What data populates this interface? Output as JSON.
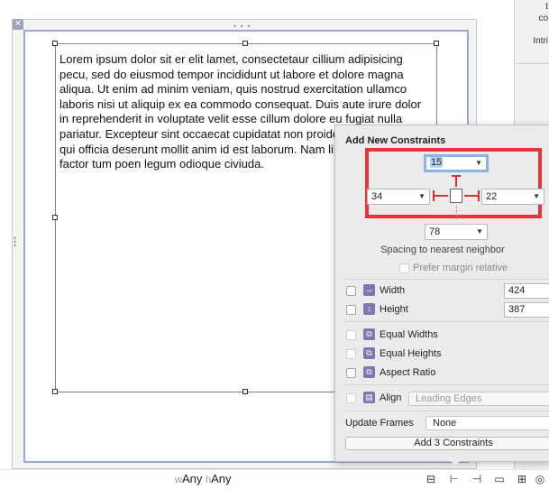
{
  "inspector_fragment": {
    "line1": "t",
    "line2": "co",
    "line3": "Intri"
  },
  "window": {
    "close_glyph": "✕",
    "grip": "• • •"
  },
  "text_view": {
    "content": "Lorem ipsum dolor sit er elit lamet, consectetaur cillium adipisicing pecu, sed do eiusmod tempor incididunt ut labore et dolore magna aliqua. Ut enim ad minim veniam, quis nostrud exercitation ullamco laboris nisi ut aliquip ex ea commodo consequat. Duis aute irure dolor in reprehenderit in voluptate velit esse cillum dolore eu fugiat nulla pariatur. Excepteur sint occaecat cupidatat non proident, sunt in culpa qui officia deserunt mollit anim id est laborum. Nam liber te conscient to factor tum poen legum odioque civiuda."
  },
  "popover": {
    "title": "Add New Constraints",
    "spacing": {
      "top": "15",
      "left": "34",
      "right": "22",
      "bottom": "78"
    },
    "spacing_caption": "Spacing to nearest neighbor",
    "prefer_margin_label": "Prefer margin relative",
    "width": {
      "label": "Width",
      "value": "424"
    },
    "height": {
      "label": "Height",
      "value": "387"
    },
    "equal_widths_label": "Equal Widths",
    "equal_heights_label": "Equal Heights",
    "aspect_ratio_label": "Aspect Ratio",
    "align": {
      "label": "Align",
      "value": "Leading Edges"
    },
    "update_frames": {
      "label": "Update Frames",
      "value": "None"
    },
    "add_button_label": "Add 3 Constraints",
    "highlight_color": "#e8323c"
  },
  "bottom_bar": {
    "width_prefix": "w",
    "width_value": "Any",
    "height_prefix": "h",
    "height_value": "Any",
    "icons": [
      "stack-icon",
      "pin-icon",
      "resolve-icon",
      "resizing-icon"
    ]
  },
  "icon_glyphs": {
    "dropdown": "▼",
    "equal": "⧉",
    "align": "▤",
    "stack": "⊟",
    "pin": "⊢",
    "resolve": "⊣",
    "resizing": "▭",
    "grid": "⊞",
    "circle": "◎"
  }
}
